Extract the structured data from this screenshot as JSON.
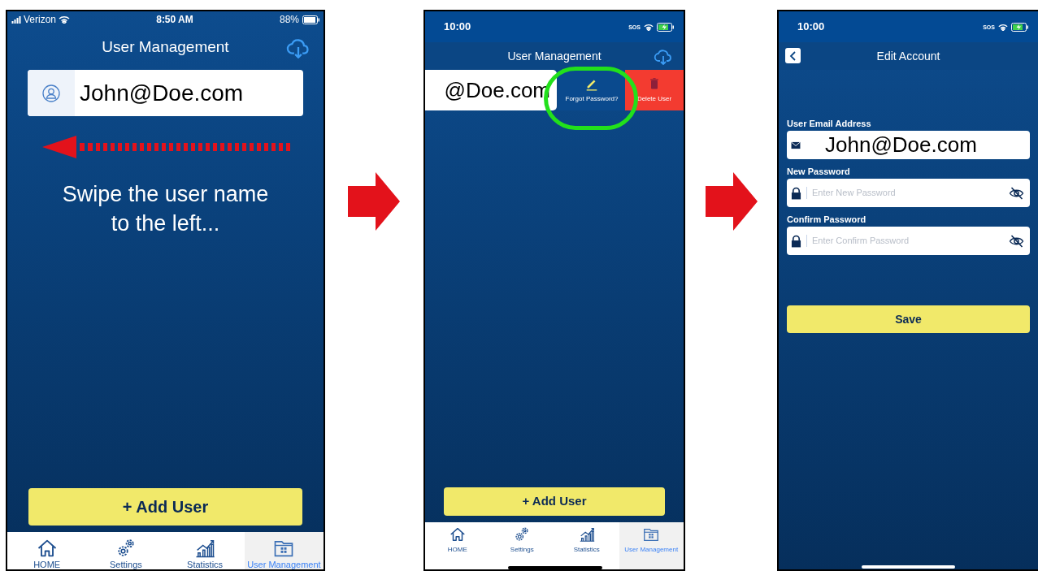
{
  "screens": [
    {
      "kind": "user_list",
      "status_bar": {
        "carrier": "Verizon",
        "time": "8:50 AM",
        "battery": "88%",
        "charging": false
      },
      "title": "User Management",
      "user_row": {
        "email": "John@Doe.com",
        "swiped": false
      },
      "hint": "Swipe the user name to the left...",
      "add_button": "+ Add User",
      "tabs": [
        {
          "kind": "home",
          "label": "HOME",
          "selected": false
        },
        {
          "kind": "settings",
          "label": "Settings",
          "selected": false
        },
        {
          "kind": "statistics",
          "label": "Statistics",
          "selected": false
        },
        {
          "kind": "users",
          "label": "User Management",
          "selected": true
        }
      ]
    },
    {
      "kind": "user_list",
      "status_bar": {
        "time": "10:00",
        "sos": "SOS",
        "charging": true
      },
      "title": "User Management",
      "user_row": {
        "email": "@Doe.com",
        "swiped": true,
        "actions": [
          {
            "kind": "edit",
            "label": "Forgot Password?",
            "highlighted": true
          },
          {
            "kind": "delete",
            "label": "Delete User",
            "highlighted": false
          }
        ]
      },
      "add_button": "+ Add User",
      "tabs": [
        {
          "kind": "home",
          "label": "HOME",
          "selected": false
        },
        {
          "kind": "settings",
          "label": "Settings",
          "selected": false
        },
        {
          "kind": "statistics",
          "label": "Statistics",
          "selected": false
        },
        {
          "kind": "users",
          "label": "User Management",
          "selected": true
        }
      ]
    },
    {
      "kind": "edit_account",
      "status_bar": {
        "time": "10:00",
        "sos": "SOS",
        "charging": true
      },
      "title": "Edit Account",
      "fields": [
        {
          "kind": "email",
          "label": "User Email Address",
          "value": "John@Doe.com"
        },
        {
          "kind": "password",
          "label": "New Password",
          "placeholder": "Enter New Password"
        },
        {
          "kind": "password",
          "label": "Confirm Password",
          "placeholder": "Enter Confirm Password"
        }
      ],
      "save_button": "Save"
    }
  ]
}
